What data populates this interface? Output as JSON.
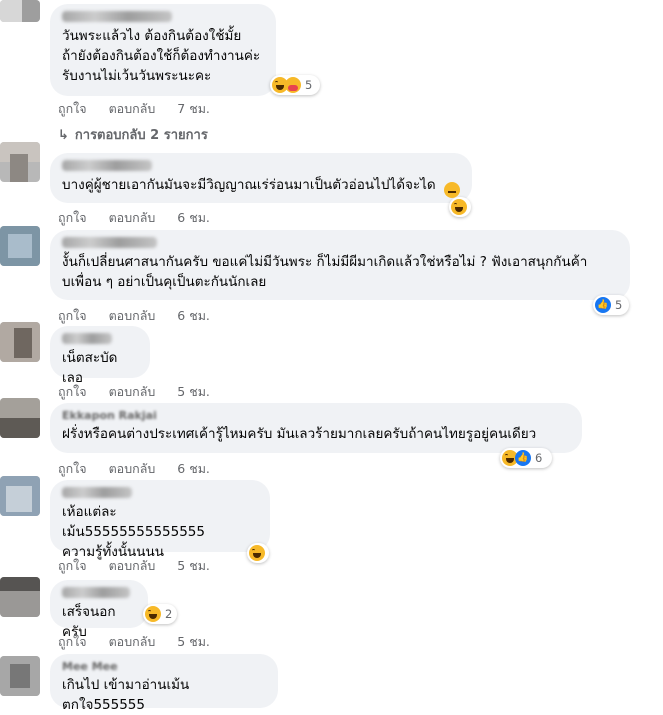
{
  "comments": [
    {
      "text": "วันพระแล้วไง ต้องกินต้องใช้มั้ย\nถ้ายังต้องกินต้องใช้ก็ต้องทำงานค่ะ\nรับงานไม่เว้นวันพระนะคะ",
      "author": "",
      "reaction_count": "5",
      "like": "ถูกใจ",
      "reply": "ตอบกลับ",
      "time": "7 ชม.",
      "replies_link": "การตอบกลับ 2 รายการ"
    },
    {
      "text": "บางคู่ผู้ชายเอากันมันจะมีวิญญาณเร่ร่อนมาเป็นตัวอ่อนไปได้จะได",
      "author": "",
      "reaction_count": "",
      "like": "ถูกใจ",
      "reply": "ตอบกลับ",
      "time": "6 ชม."
    },
    {
      "text": "งั้นก็เปลี่ยนศาสนากันครับ ขอแค่ไม่มีวันพระ ก็ไม่มีผีมาเกิดแล้วใช่หรือไม่ ? ฟังเอาสนุกกันค้า\nบเพื่อน ๆ อย่าเป็นคุเป็นตะกันนักเลย",
      "author": "",
      "reaction_count": "5",
      "like": "ถูกใจ",
      "reply": "ตอบกลับ",
      "time": "6 ชม."
    },
    {
      "text": "เน็ตสะบัดเลอ",
      "author": "",
      "reaction_count": "",
      "like": "ถูกใจ",
      "reply": "ตอบกลับ",
      "time": "5 ชม."
    },
    {
      "text": "ฝรั่งหรือคนต่างประเทศเค้ารู้ไหมครับ มันเลวร้ายมากเลยครับถ้าคนไทยรูอยู่คนเดียว",
      "author": "Ekkapon Rakjai",
      "reaction_count": "6",
      "like": "ถูกใจ",
      "reply": "ตอบกลับ",
      "time": "6 ชม."
    },
    {
      "text": "เห้อแต่ละเม้น55555555555555\nความรู้ทั้งนั้นนนน",
      "author": "",
      "reaction_count": "",
      "like": "ถูกใจ",
      "reply": "ตอบกลับ",
      "time": "5 ชม."
    },
    {
      "text": "เสร็จนอกครับ",
      "author": "",
      "reaction_count": "2",
      "like": "ถูกใจ",
      "reply": "ตอบกลับ",
      "time": "5 ชม."
    },
    {
      "text": "เกินไป เข้ามาอ่านเม้นตกใจ555555",
      "author": "Mee Mee",
      "reaction_count": "",
      "like": "",
      "reply": "",
      "time": ""
    }
  ],
  "colors": {
    "bubble": "#f0f2f5",
    "meta": "#65676b",
    "like_blue": "#1877f2",
    "haha_yellow": "#f7b928"
  },
  "icons": [
    "haha-icon",
    "care-icon",
    "like-icon",
    "meh-icon",
    "reply-arrow-icon"
  ]
}
